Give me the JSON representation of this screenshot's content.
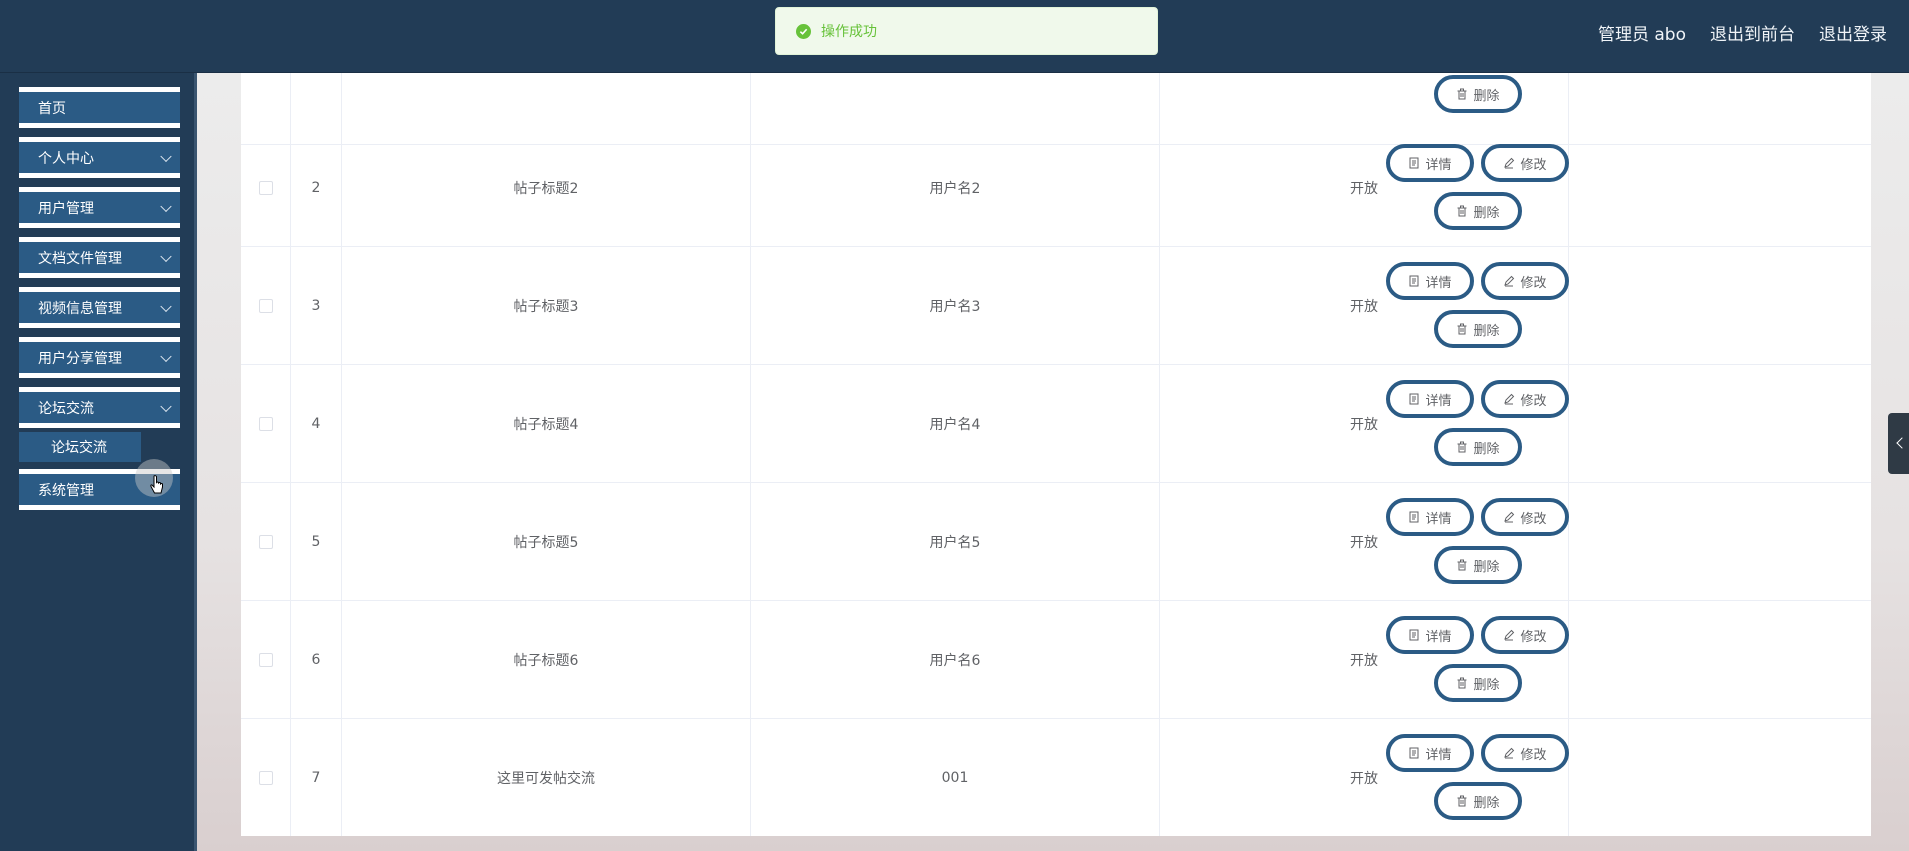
{
  "header": {
    "admin_label": "管理员 abo",
    "front_link": "退出到前台",
    "logout_link": "退出登录"
  },
  "toast": {
    "message": "操作成功"
  },
  "sidebar": {
    "items": [
      {
        "label": "首页"
      },
      {
        "label": "个人中心"
      },
      {
        "label": "用户管理"
      },
      {
        "label": "文档文件管理"
      },
      {
        "label": "视频信息管理"
      },
      {
        "label": "用户分享管理"
      },
      {
        "label": "论坛交流"
      },
      {
        "label": "系统管理"
      }
    ],
    "sub_item": "论坛交流"
  },
  "table": {
    "rows": [
      {
        "index": "2",
        "title": "帖子标题2",
        "user": "用户名2",
        "status": "开放"
      },
      {
        "index": "3",
        "title": "帖子标题3",
        "user": "用户名3",
        "status": "开放"
      },
      {
        "index": "4",
        "title": "帖子标题4",
        "user": "用户名4",
        "status": "开放"
      },
      {
        "index": "5",
        "title": "帖子标题5",
        "user": "用户名5",
        "status": "开放"
      },
      {
        "index": "6",
        "title": "帖子标题6",
        "user": "用户名6",
        "status": "开放"
      },
      {
        "index": "7",
        "title": "这里可发帖交流",
        "user": "001",
        "status": "开放"
      }
    ],
    "actions": {
      "detail": "详情",
      "edit": "修改",
      "delete": "删除"
    }
  },
  "colors": {
    "header_bg": "#223c56",
    "button_border": "#2b5b85",
    "success": "#67c23a"
  }
}
